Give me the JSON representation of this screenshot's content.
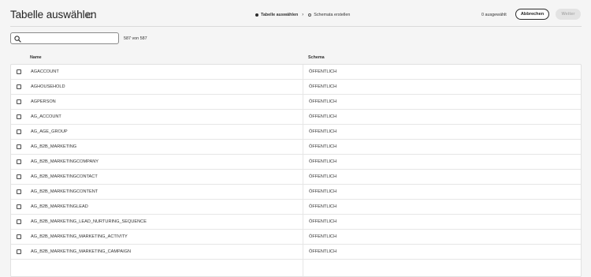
{
  "header": {
    "title": "Tabelle auswählen",
    "info_icon": "info-icon",
    "steps": [
      {
        "label": "Tabelle auswählen",
        "state": "active"
      },
      {
        "label": "Schemata erstellen",
        "state": "pending"
      }
    ],
    "selected_count": "0 ausgewählt",
    "cancel_label": "Abbrechen",
    "next_label": "Weiter"
  },
  "search": {
    "placeholder": "",
    "value": "",
    "icon": "search-icon",
    "result_count": "587 von 587"
  },
  "table": {
    "columns": [
      "Name",
      "Schema"
    ],
    "rows": [
      {
        "name": "AGACCOUNT",
        "schema": "ÖFFENTLICH"
      },
      {
        "name": "AGHOUSEHOLD",
        "schema": "ÖFFENTLICH"
      },
      {
        "name": "AGPERSON",
        "schema": "ÖFFENTLICH"
      },
      {
        "name": "AG_ACCOUNT",
        "schema": "ÖFFENTLICH"
      },
      {
        "name": "AG_AGE_GROUP",
        "schema": "ÖFFENTLICH"
      },
      {
        "name": "AG_B2B_MARKETING",
        "schema": "ÖFFENTLICH"
      },
      {
        "name": "AG_B2B_MARKETINGCOMPANY",
        "schema": "ÖFFENTLICH"
      },
      {
        "name": "AG_B2B_MARKETINGCONTACT",
        "schema": "ÖFFENTLICH"
      },
      {
        "name": "AG_B2B_MARKETINGCONTENT",
        "schema": "ÖFFENTLICH"
      },
      {
        "name": "AG_B2B_MARKETINGLEAD",
        "schema": "ÖFFENTLICH"
      },
      {
        "name": "AG_B2B_MARKETING_LEAD_NURTURING_SEQUENCE",
        "schema": "ÖFFENTLICH"
      },
      {
        "name": "AG_B2B_MARKETING_MARKETING_ACTIVITY",
        "schema": "ÖFFENTLICH"
      },
      {
        "name": "AG_B2B_MARKETING_MARKETING_CAMPAIGN",
        "schema": "ÖFFENTLICH"
      }
    ]
  }
}
